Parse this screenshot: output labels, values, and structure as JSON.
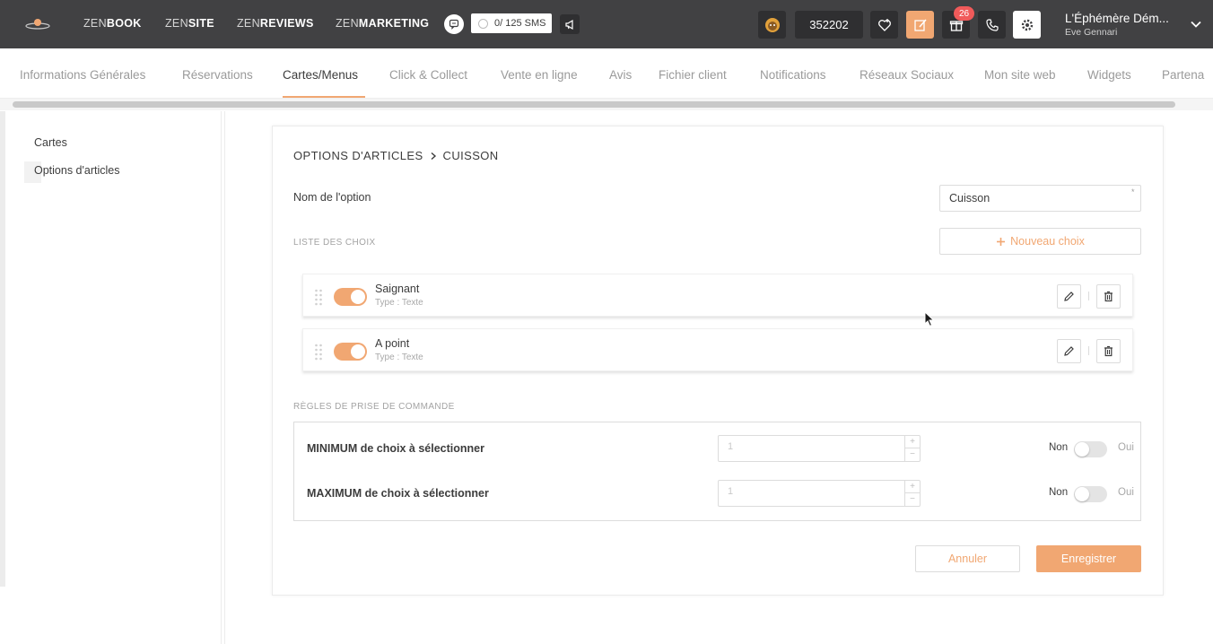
{
  "colors": {
    "topbar": "#414143",
    "accent": "#f1a772",
    "badge": "#f05a5a"
  },
  "topbar": {
    "nav": [
      {
        "light": "ZEN",
        "bold": "BOOK"
      },
      {
        "light": "ZEN",
        "bold": "SITE"
      },
      {
        "light": "ZEN",
        "bold": "REVIEWS"
      },
      {
        "light": "ZEN",
        "bold": "MARKETING"
      }
    ],
    "sms_counter": "0/ 125 SMS",
    "counter_value": "352202",
    "notification_count": "26",
    "restaurant_name": "L'Éphémère Dém...",
    "user_name": "Eve Gennari",
    "icons": [
      "logo-icon",
      "chat-icon",
      "megaphone-icon",
      "lion-icon",
      "heart-plus-icon",
      "edit-note-icon",
      "gift-icon",
      "phone-icon",
      "gear-icon",
      "chevron-down-icon"
    ]
  },
  "tabs": [
    "Informations Générales",
    "Réservations",
    "Cartes/Menus",
    "Click & Collect",
    "Vente en ligne",
    "Avis",
    "Fichier client",
    "Notifications",
    "Réseaux Sociaux",
    "Mon site web",
    "Widgets",
    "Partena"
  ],
  "active_tab": "Cartes/Menus",
  "sidebar": {
    "items": [
      "Cartes",
      "Options d'articles"
    ],
    "active": "Options d'articles"
  },
  "form": {
    "breadcrumb_parent": "OPTIONS D'ARTICLES",
    "breadcrumb_current": "CUISSON",
    "option_name_label": "Nom de l'option",
    "option_name_value": "Cuisson",
    "required_mark": "*",
    "choices_section_title": "LISTE DES CHOIX",
    "new_choice_label": "Nouveau choix",
    "choices": [
      {
        "name": "Saignant",
        "type": "Type : Texte",
        "enabled": true
      },
      {
        "name": "A point",
        "type": "Type : Texte",
        "enabled": true
      }
    ],
    "rules_section_title": "RÈGLES DE PRISE DE COMMANDE",
    "rules": [
      {
        "label": "MINIMUM de choix à sélectionner",
        "value": "1",
        "no": "Non",
        "yes": "Oui",
        "enabled": false
      },
      {
        "label": "MAXIMUM de choix à sélectionner",
        "value": "1",
        "no": "Non",
        "yes": "Oui",
        "enabled": false
      }
    ],
    "cancel_label": "Annuler",
    "save_label": "Enregistrer"
  }
}
